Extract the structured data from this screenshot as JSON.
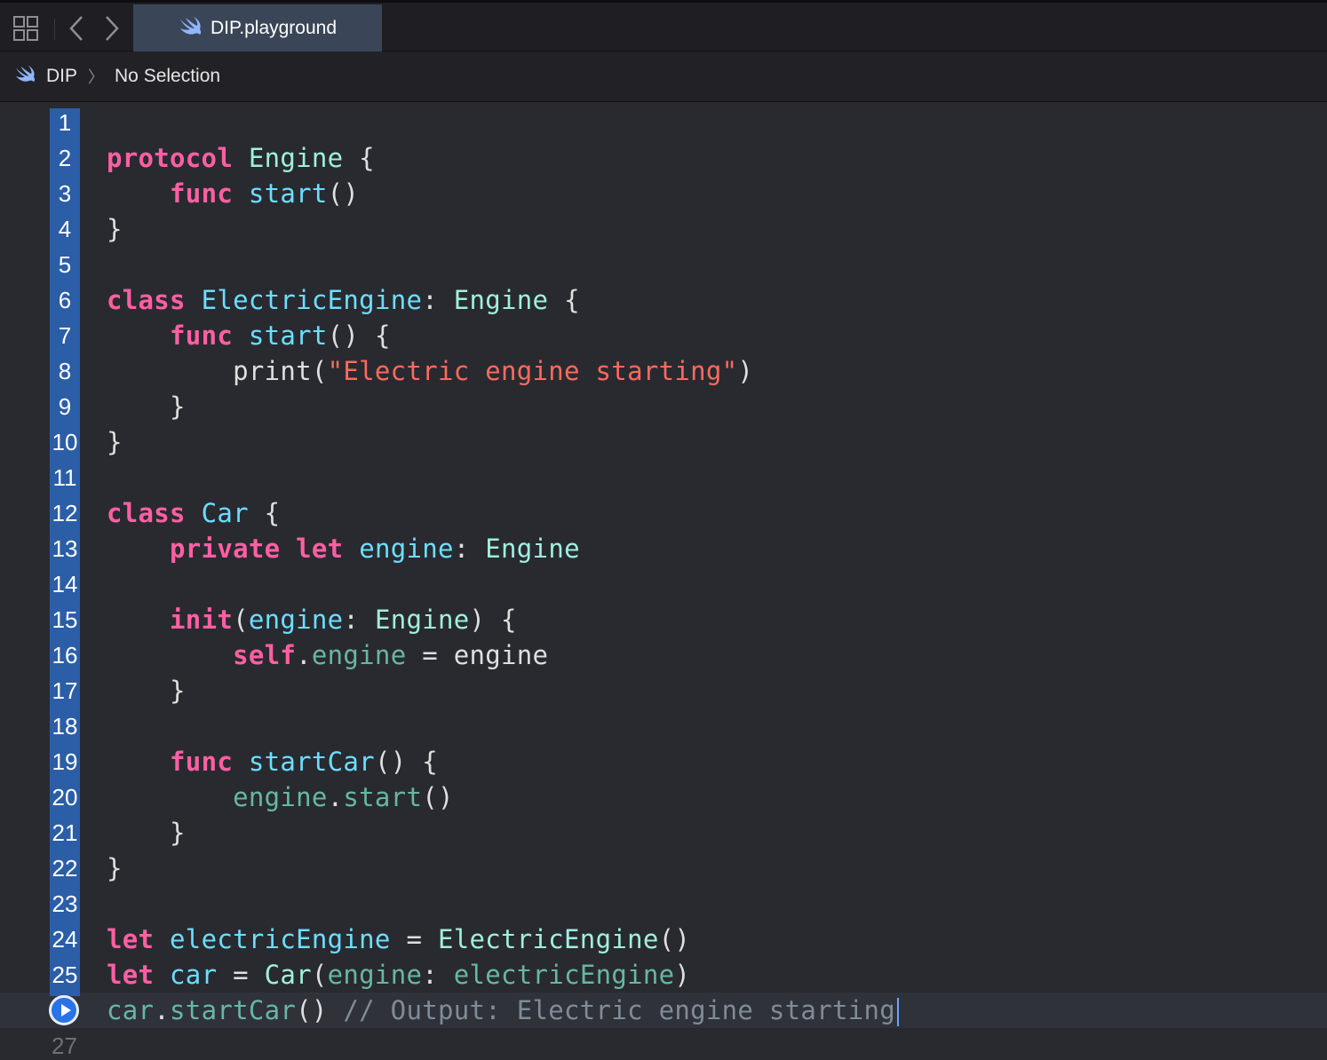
{
  "toolbar": {
    "tab_title": "DIP.playground"
  },
  "pathbar": {
    "crumbs": [
      "DIP",
      "No Selection"
    ]
  },
  "editor": {
    "line_numbers": [
      "1",
      "2",
      "3",
      "4",
      "5",
      "6",
      "7",
      "8",
      "9",
      "10",
      "11",
      "12",
      "13",
      "14",
      "15",
      "16",
      "17",
      "18",
      "19",
      "20",
      "21",
      "22",
      "23",
      "24",
      "25"
    ],
    "next_line_number": "27",
    "lines": [
      [],
      [
        [
          "kw",
          "protocol"
        ],
        [
          "pl",
          " "
        ],
        [
          "ty",
          "Engine"
        ],
        [
          "pl",
          " {"
        ]
      ],
      [
        [
          "pl",
          "    "
        ],
        [
          "kw",
          "func"
        ],
        [
          "pl",
          " "
        ],
        [
          "fn",
          "start"
        ],
        [
          "pl",
          "()"
        ]
      ],
      [
        [
          "pl",
          "}"
        ]
      ],
      [],
      [
        [
          "kw",
          "class"
        ],
        [
          "pl",
          " "
        ],
        [
          "fn",
          "ElectricEngine"
        ],
        [
          "pl",
          ": "
        ],
        [
          "ty",
          "Engine"
        ],
        [
          "pl",
          " {"
        ]
      ],
      [
        [
          "pl",
          "    "
        ],
        [
          "kw",
          "func"
        ],
        [
          "pl",
          " "
        ],
        [
          "fn",
          "start"
        ],
        [
          "pl",
          "() {"
        ]
      ],
      [
        [
          "pl",
          "        print("
        ],
        [
          "st",
          "\"Electric engine starting\""
        ],
        [
          "pl",
          ")"
        ]
      ],
      [
        [
          "pl",
          "    }"
        ]
      ],
      [
        [
          "pl",
          "}"
        ]
      ],
      [],
      [
        [
          "kw",
          "class"
        ],
        [
          "pl",
          " "
        ],
        [
          "fn",
          "Car"
        ],
        [
          "pl",
          " {"
        ]
      ],
      [
        [
          "pl",
          "    "
        ],
        [
          "kw",
          "private"
        ],
        [
          "pl",
          " "
        ],
        [
          "kw",
          "let"
        ],
        [
          "pl",
          " "
        ],
        [
          "fn",
          "engine"
        ],
        [
          "pl",
          ": "
        ],
        [
          "ty",
          "Engine"
        ]
      ],
      [],
      [
        [
          "pl",
          "    "
        ],
        [
          "kw",
          "init"
        ],
        [
          "pl",
          "("
        ],
        [
          "fn",
          "engine"
        ],
        [
          "pl",
          ": "
        ],
        [
          "ty",
          "Engine"
        ],
        [
          "pl",
          ") {"
        ]
      ],
      [
        [
          "pl",
          "        "
        ],
        [
          "kw",
          "self"
        ],
        [
          "pl",
          "."
        ],
        [
          "nm",
          "engine"
        ],
        [
          "pl",
          " = engine"
        ]
      ],
      [
        [
          "pl",
          "    }"
        ]
      ],
      [],
      [
        [
          "pl",
          "    "
        ],
        [
          "kw",
          "func"
        ],
        [
          "pl",
          " "
        ],
        [
          "fn",
          "startCar"
        ],
        [
          "pl",
          "() {"
        ]
      ],
      [
        [
          "pl",
          "        "
        ],
        [
          "nm",
          "engine"
        ],
        [
          "pl",
          "."
        ],
        [
          "nm",
          "start"
        ],
        [
          "pl",
          "()"
        ]
      ],
      [
        [
          "pl",
          "    }"
        ]
      ],
      [
        [
          "pl",
          "}"
        ]
      ],
      [],
      [
        [
          "kw",
          "let"
        ],
        [
          "pl",
          " "
        ],
        [
          "fn",
          "electricEngine"
        ],
        [
          "pl",
          " = "
        ],
        [
          "ty",
          "ElectricEngine"
        ],
        [
          "pl",
          "()"
        ]
      ],
      [
        [
          "kw",
          "let"
        ],
        [
          "pl",
          " "
        ],
        [
          "fn",
          "car"
        ],
        [
          "pl",
          " = "
        ],
        [
          "ty",
          "Car"
        ],
        [
          "pl",
          "("
        ],
        [
          "nm",
          "engine"
        ],
        [
          "pl",
          ": "
        ],
        [
          "nm",
          "electricEngine"
        ],
        [
          "pl",
          ")"
        ]
      ],
      [
        [
          "nm",
          "car"
        ],
        [
          "pl",
          "."
        ],
        [
          "nm",
          "startCar"
        ],
        [
          "pl",
          "() "
        ],
        [
          "cm",
          "// Output: Electric engine starting"
        ]
      ]
    ]
  }
}
